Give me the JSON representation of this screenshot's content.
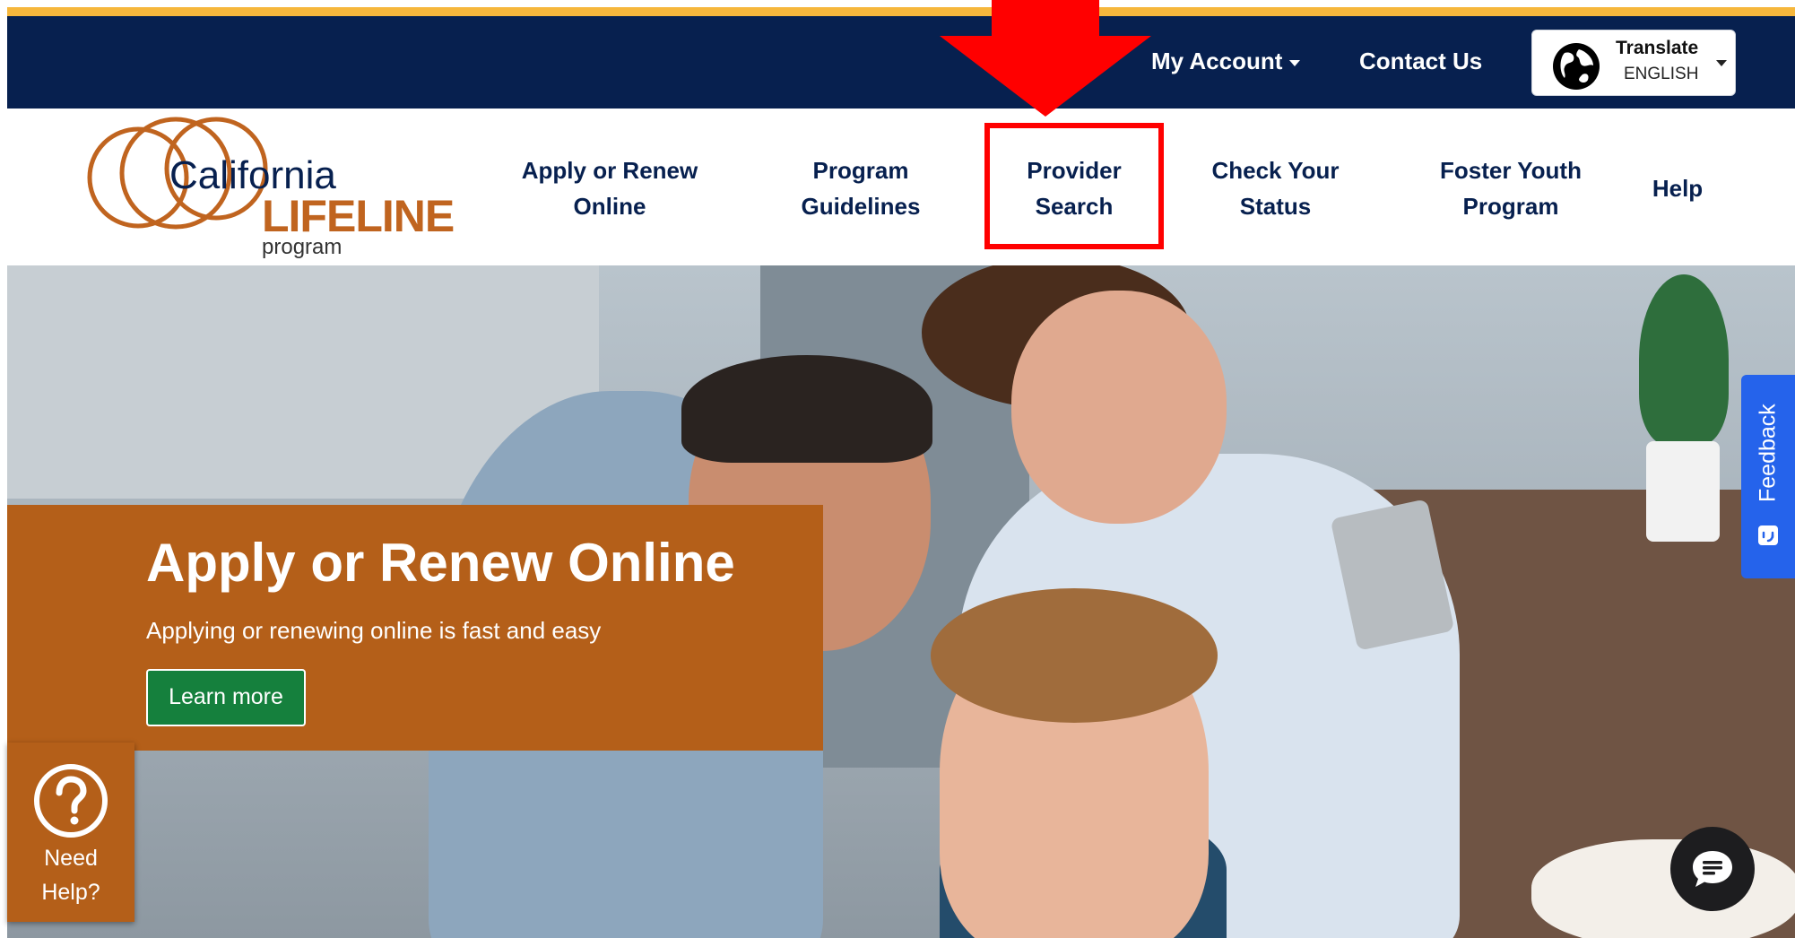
{
  "top_nav": {
    "my_account": "My Account",
    "contact_us": "Contact Us",
    "translate": {
      "title": "Translate",
      "language": "ENGLISH"
    }
  },
  "logo": {
    "line1": "California",
    "line2": "LIFELINE",
    "line3": "program"
  },
  "main_nav": [
    {
      "line1": "Apply or Renew",
      "line2": "Online"
    },
    {
      "line1": "Program",
      "line2": "Guidelines"
    },
    {
      "line1": "Provider",
      "line2": "Search"
    },
    {
      "line1": "Check Your",
      "line2": "Status"
    },
    {
      "line1": "Foster Youth",
      "line2": "Program"
    },
    {
      "line1": "Help",
      "line2": ""
    }
  ],
  "hero": {
    "title": "Apply or Renew Online",
    "subtitle": "Applying or renewing online is fast and easy",
    "button": "Learn more"
  },
  "need_help": {
    "line1": "Need",
    "line2": "Help?"
  },
  "feedback": {
    "label": "Feedback"
  },
  "colors": {
    "navy": "#07204f",
    "gold": "#f6b73c",
    "orange": "#b45f19",
    "green": "#15803d",
    "feedback_blue": "#2563eb",
    "highlight_red": "#ff0000"
  },
  "icons": {
    "globe": "globe-icon",
    "question": "question-circle-icon",
    "chat": "chat-icon",
    "feedback": "smiley-icon"
  }
}
